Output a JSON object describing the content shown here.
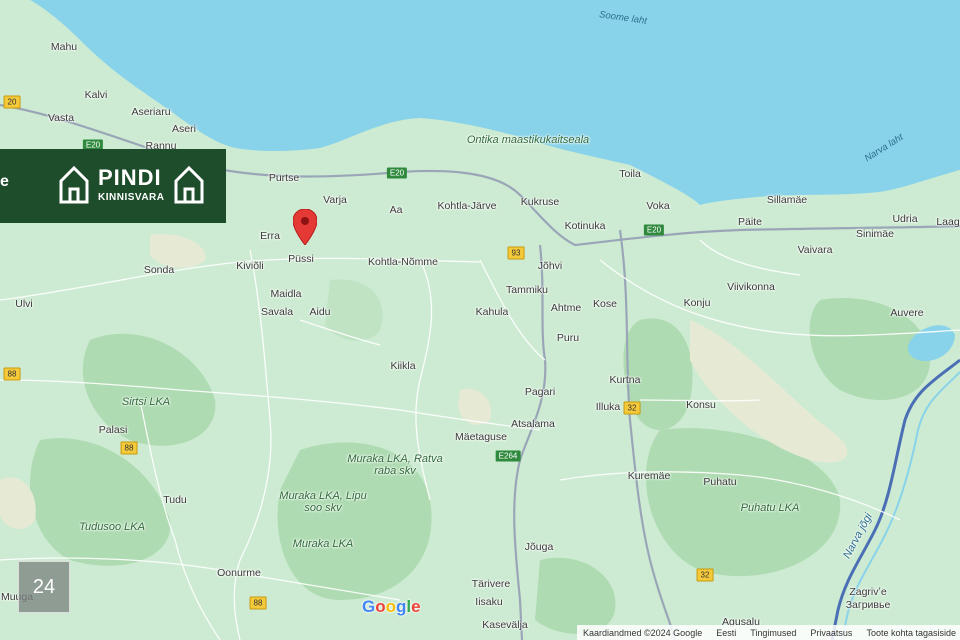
{
  "map": {
    "water_labels": [
      "Soome laht",
      "Narva laht"
    ],
    "place_labels": [
      "Mahu",
      "Kalvi",
      "Aseriaru",
      "Vasta",
      "Aseri",
      "Rannu",
      "Purtse",
      "Varja",
      "Aa",
      "Kohtla-Järve",
      "Kukruse",
      "Toila",
      "Voka",
      "Sillamäe",
      "Päite",
      "Udria",
      "Laag",
      "Sinimäe",
      "Vaivara",
      "Erra",
      "Püssi",
      "Kiviõli",
      "Sonda",
      "Kohtla-Nõmme",
      "Jõhvi",
      "Kotinuka",
      "Tammiku",
      "Ahtme",
      "Kose",
      "Konju",
      "Viivikonna",
      "Auvere",
      "Ulvi",
      "Maidla",
      "Savala",
      "Aidu",
      "Kahula",
      "Puru",
      "Kiikla",
      "Kurtna",
      "Pagari",
      "Illuka",
      "Konsu",
      "Palasi",
      "Atsalama",
      "Mäetaguse",
      "Kuremäe",
      "Puhatu",
      "Tudu",
      "Oonurme",
      "Jõuga",
      "Tärivere",
      "Iisaku",
      "Kasevälja",
      "Agusalu",
      "Muuga",
      "Zagrivʼe",
      "Загривье"
    ],
    "park_labels": [
      "Ontika maastikukaitseala",
      "Sirtsi LKA",
      "Muraka LKA, Ratva raba skv",
      "Muraka LKA, Lipu soo skv",
      "Muraka LKA",
      "Tudusoo LKA",
      "Puhatu LKA",
      "Narva jõgi"
    ],
    "road_shields": [
      {
        "label": "20",
        "type": "yellow"
      },
      {
        "label": "E20",
        "type": "green"
      },
      {
        "label": "E20",
        "type": "green"
      },
      {
        "label": "E20",
        "type": "green"
      },
      {
        "label": "93",
        "type": "yellow"
      },
      {
        "label": "88",
        "type": "yellow"
      },
      {
        "label": "88",
        "type": "yellow"
      },
      {
        "label": "88",
        "type": "yellow"
      },
      {
        "label": "32",
        "type": "yellow"
      },
      {
        "label": "E264",
        "type": "green"
      },
      {
        "label": "32",
        "type": "yellow"
      }
    ],
    "marker": {
      "name": "location-pin",
      "color": "#e53935"
    }
  },
  "brand": {
    "edge_text": "e",
    "title": "PINDI",
    "subtitle": "KINNISVARA",
    "bg": "#1d4d2b"
  },
  "badge": {
    "text": "24"
  },
  "google_logo": [
    "G",
    "o",
    "o",
    "g",
    "l",
    "e"
  ],
  "attribution": {
    "data": "Kaardiandmed ©2024 Google",
    "lang": "Eesti",
    "terms": "Tingimused",
    "privacy": "Privaatsus",
    "feedback": "Toote kohta tagasiside"
  },
  "colors": {
    "sea": "#89d3ea",
    "land": "#c9e9cf",
    "forest": "#a9d9ad",
    "road": "#9aa6b8",
    "road_minor": "#ffffff"
  }
}
